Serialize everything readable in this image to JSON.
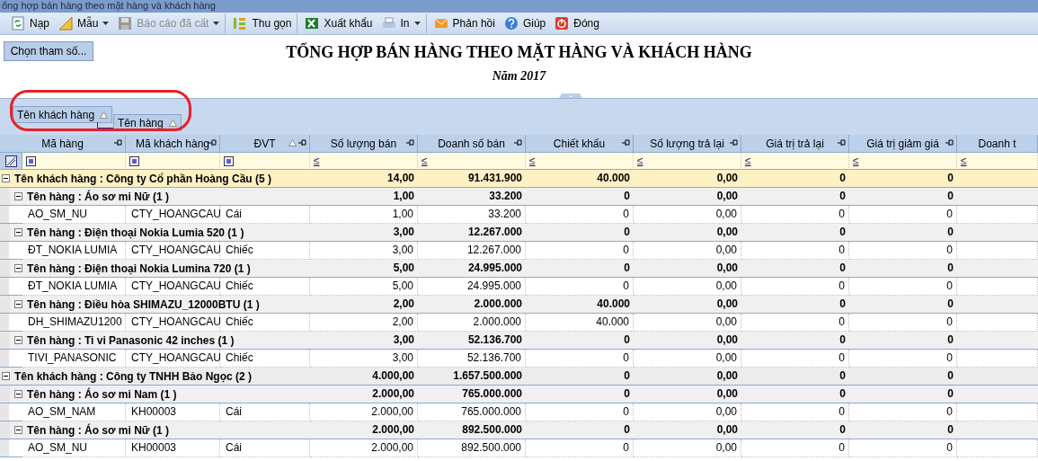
{
  "window": {
    "title": "ổng hợp bán hàng theo mặt hàng và khách hàng"
  },
  "toolbar": [
    {
      "kind": "reload",
      "label": "Nạp",
      "dropdown": false,
      "disabled": false,
      "separator_before": false
    },
    {
      "kind": "template",
      "label": "Mẫu",
      "dropdown": true,
      "disabled": false,
      "separator_before": false
    },
    {
      "kind": "saved",
      "label": "Báo cáo đã cất",
      "dropdown": true,
      "disabled": true,
      "separator_before": false
    },
    {
      "kind": "collapse",
      "label": "Thu gọn",
      "dropdown": false,
      "disabled": false,
      "separator_before": true
    },
    {
      "kind": "excel",
      "label": "Xuất khẩu",
      "dropdown": false,
      "disabled": false,
      "separator_before": true
    },
    {
      "kind": "print",
      "label": "In",
      "dropdown": true,
      "disabled": false,
      "separator_before": false
    },
    {
      "kind": "feedback",
      "label": "Phản hồi",
      "dropdown": false,
      "disabled": false,
      "separator_before": true
    },
    {
      "kind": "help",
      "label": "Giúp",
      "dropdown": false,
      "disabled": false,
      "separator_before": false
    },
    {
      "kind": "close",
      "label": "Đóng",
      "dropdown": false,
      "disabled": false,
      "separator_before": false
    }
  ],
  "params_button": {
    "label": "Chọn tham số..."
  },
  "report": {
    "title": "TỔNG HỢP BÁN HÀNG THEO MẶT HÀNG VÀ KHÁCH HÀNG",
    "subtitle": "Năm 2017"
  },
  "group_panel": {
    "chips": [
      {
        "label": "Tên khách hàng",
        "sorted": true
      },
      {
        "label": "Tên hàng",
        "sorted": true
      }
    ]
  },
  "table": {
    "columns": [
      {
        "label": "Mã hàng",
        "pinned": true,
        "sorted": false,
        "filter": {
          "kind": "check"
        }
      },
      {
        "label": "Mã khách hàng",
        "pinned": true,
        "sorted": false,
        "filter": {
          "kind": "check"
        }
      },
      {
        "label": "ĐVT",
        "pinned": true,
        "sorted": true,
        "filter": {
          "kind": "check"
        }
      },
      {
        "label": "Số lượng bán",
        "pinned": true,
        "sorted": false,
        "filter": {
          "kind": "operator",
          "symbol": "≤"
        }
      },
      {
        "label": "Doanh số bán",
        "pinned": true,
        "sorted": false,
        "filter": {
          "kind": "operator",
          "symbol": "≤"
        }
      },
      {
        "label": "Chiết khấu",
        "pinned": true,
        "sorted": false,
        "filter": {
          "kind": "operator",
          "symbol": "≤"
        }
      },
      {
        "label": "Số lượng trả lại",
        "pinned": true,
        "sorted": false,
        "filter": {
          "kind": "operator",
          "symbol": "≤"
        }
      },
      {
        "label": "Giá trị trả lại",
        "pinned": true,
        "sorted": false,
        "filter": {
          "kind": "operator",
          "symbol": "≤"
        }
      },
      {
        "label": "Giá trị giảm giá",
        "pinned": true,
        "sorted": false,
        "filter": {
          "kind": "operator",
          "symbol": "≤"
        }
      },
      {
        "label": "Doanh t",
        "pinned": false,
        "sorted": false,
        "filter": {
          "kind": "operator",
          "symbol": "≤"
        }
      }
    ],
    "groups": [
      {
        "label": "Tên khách hàng : Công ty Cổ phần Hoàng Cầu (5 )",
        "selected": true,
        "expanded": true,
        "values": [
          "14,00",
          "91.431.900",
          "40.000",
          "0,00",
          "0",
          "0"
        ],
        "children": [
          {
            "label": "Tên hàng : Áo sơ mi Nữ (1 )",
            "expanded": true,
            "values": [
              "1,00",
              "33.200",
              "0",
              "0,00",
              "0",
              "0"
            ],
            "children": [
              {
                "cells": [
                  "AO_SM_NU",
                  "CTY_HOANGCAU",
                  "Cái",
                  "1,00",
                  "33.200",
                  "0",
                  "0,00",
                  "0",
                  "0"
                ]
              }
            ]
          },
          {
            "label": "Tên hàng : Điện thoại Nokia Lumia 520 (1 )",
            "expanded": true,
            "values": [
              "3,00",
              "12.267.000",
              "0",
              "0,00",
              "0",
              "0"
            ],
            "children": [
              {
                "cells": [
                  "ĐT_NOKIA LUMIA",
                  "CTY_HOANGCAU",
                  "Chiếc",
                  "3,00",
                  "12.267.000",
                  "0",
                  "0,00",
                  "0",
                  "0"
                ]
              }
            ]
          },
          {
            "label": "Tên hàng : Điện thoại Nokia Lumina 720 (1 )",
            "expanded": true,
            "values": [
              "5,00",
              "24.995.000",
              "0",
              "0,00",
              "0",
              "0"
            ],
            "children": [
              {
                "cells": [
                  "ĐT_NOKIA LUMIA",
                  "CTY_HOANGCAU",
                  "Chiếc",
                  "5,00",
                  "24.995.000",
                  "0",
                  "0,00",
                  "0",
                  "0"
                ]
              }
            ]
          },
          {
            "label": "Tên hàng : Điều hòa SHIMAZU_12000BTU (1 )",
            "expanded": true,
            "values": [
              "2,00",
              "2.000.000",
              "40.000",
              "0,00",
              "0",
              "0"
            ],
            "children": [
              {
                "cells": [
                  "DH_SHIMAZU1200",
                  "CTY_HOANGCAU",
                  "Chiếc",
                  "2,00",
                  "2.000.000",
                  "40.000",
                  "0,00",
                  "0",
                  "0"
                ]
              }
            ]
          },
          {
            "label": "Tên hàng : Ti vi Panasonic 42 inches (1 )",
            "expanded": true,
            "values": [
              "3,00",
              "52.136.700",
              "0",
              "0,00",
              "0",
              "0"
            ],
            "children": [
              {
                "cells": [
                  "TIVI_PANASONIC",
                  "CTY_HOANGCAU",
                  "Chiếc",
                  "3,00",
                  "52.136.700",
                  "0",
                  "0,00",
                  "0",
                  "0"
                ]
              }
            ]
          }
        ]
      },
      {
        "label": "Tên khách hàng : Công ty TNHH Bảo Ngọc (2 )",
        "selected": false,
        "expanded": true,
        "values": [
          "4.000,00",
          "1.657.500.000",
          "0",
          "0,00",
          "0",
          "0"
        ],
        "children": [
          {
            "label": "Tên hàng : Áo sơ mi Nam (1 )",
            "expanded": true,
            "values": [
              "2.000,00",
              "765.000.000",
              "0",
              "0,00",
              "0",
              "0"
            ],
            "children": [
              {
                "cells": [
                  "AO_SM_NAM",
                  "KH00003",
                  "Cái",
                  "2.000,00",
                  "765.000.000",
                  "0",
                  "0,00",
                  "0",
                  "0"
                ]
              }
            ]
          },
          {
            "label": "Tên hàng : Áo sơ mi Nữ (1 )",
            "expanded": true,
            "values": [
              "2.000,00",
              "892.500.000",
              "0",
              "0,00",
              "0",
              "0"
            ],
            "children": [
              {
                "cells": [
                  "AO_SM_NU",
                  "KH00003",
                  "Cái",
                  "2.000,00",
                  "892.500.000",
                  "0",
                  "0,00",
                  "0",
                  "0"
                ]
              }
            ]
          }
        ]
      }
    ]
  }
}
